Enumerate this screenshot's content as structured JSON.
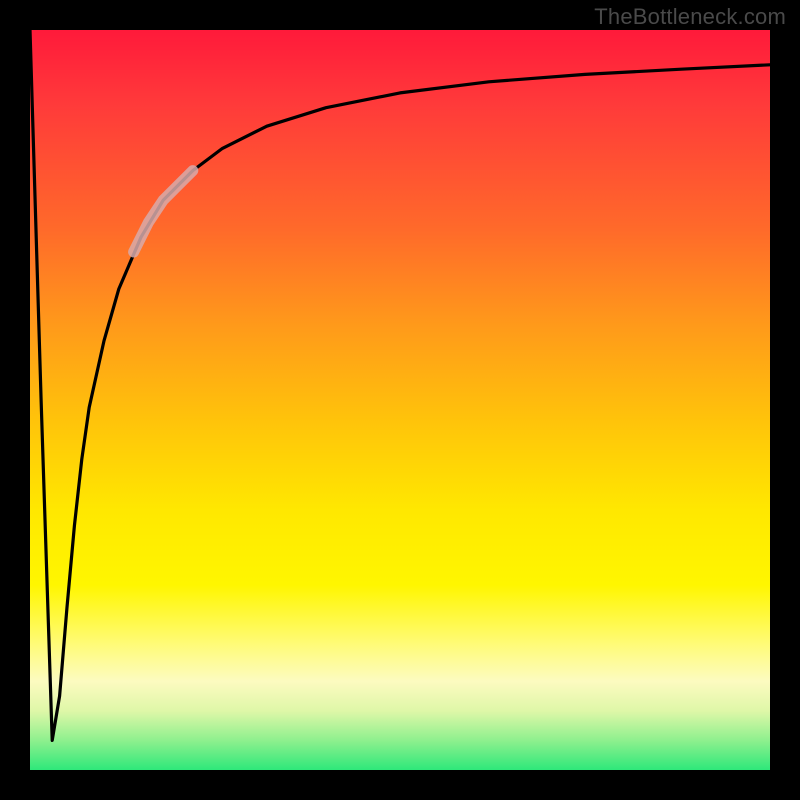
{
  "watermark": "TheBottleneck.com",
  "colors": {
    "frame": "#000000",
    "curve": "#000000",
    "highlight": "#d8aaaa"
  },
  "chart_data": {
    "type": "line",
    "title": "",
    "xlabel": "",
    "ylabel": "",
    "xlim": [
      0,
      100
    ],
    "ylim": [
      0,
      100
    ],
    "grid": false,
    "legend": false,
    "gradient_note": "vertical red→yellow→green gradient; red ≈ high bottleneck, green ≈ low",
    "series": [
      {
        "name": "bottleneck-curve",
        "x": [
          0,
          1.5,
          3,
          4,
          5,
          6,
          7,
          8,
          10,
          12,
          15,
          18,
          22,
          26,
          32,
          40,
          50,
          62,
          75,
          88,
          100
        ],
        "y": [
          100,
          50,
          4,
          10,
          22,
          33,
          42,
          49,
          58,
          65,
          72,
          77,
          81,
          84,
          87,
          89.5,
          91.5,
          93,
          94,
          94.7,
          95.3
        ]
      },
      {
        "name": "highlight-segment",
        "x": [
          14,
          16,
          18,
          20,
          22
        ],
        "y": [
          70,
          74,
          77,
          79,
          81
        ]
      }
    ]
  }
}
